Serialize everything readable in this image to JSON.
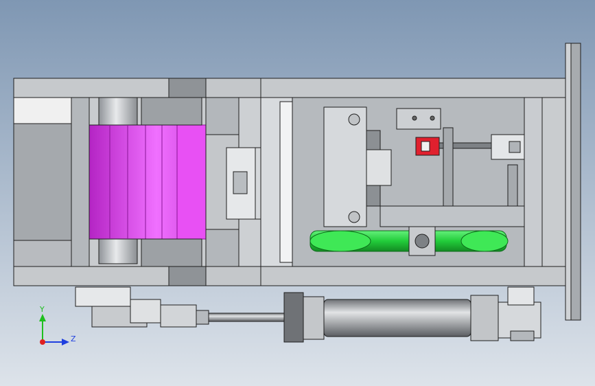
{
  "viewport": {
    "background_top": "#7f97b3",
    "background_bottom": "#dde3ea"
  },
  "triad": {
    "y_label": "Y",
    "z_label": "Z",
    "x_color": "#e02020",
    "y_color": "#1fbf1f",
    "z_color": "#1f3fdf"
  },
  "colors": {
    "frame": "#c9cccf",
    "frame_dark": "#9fa3a7",
    "frame_shadow": "#6e7277",
    "edge": "#1e1e1e",
    "belt_magenta": "#e040ee",
    "belt_magenta_dark": "#9b1aa8",
    "belt_green": "#2fe04a",
    "belt_green_dark": "#149a28",
    "sensor_red": "#e0202e",
    "cylinder": "#9ea1a4",
    "cylinder_dark": "#5c5f63"
  }
}
